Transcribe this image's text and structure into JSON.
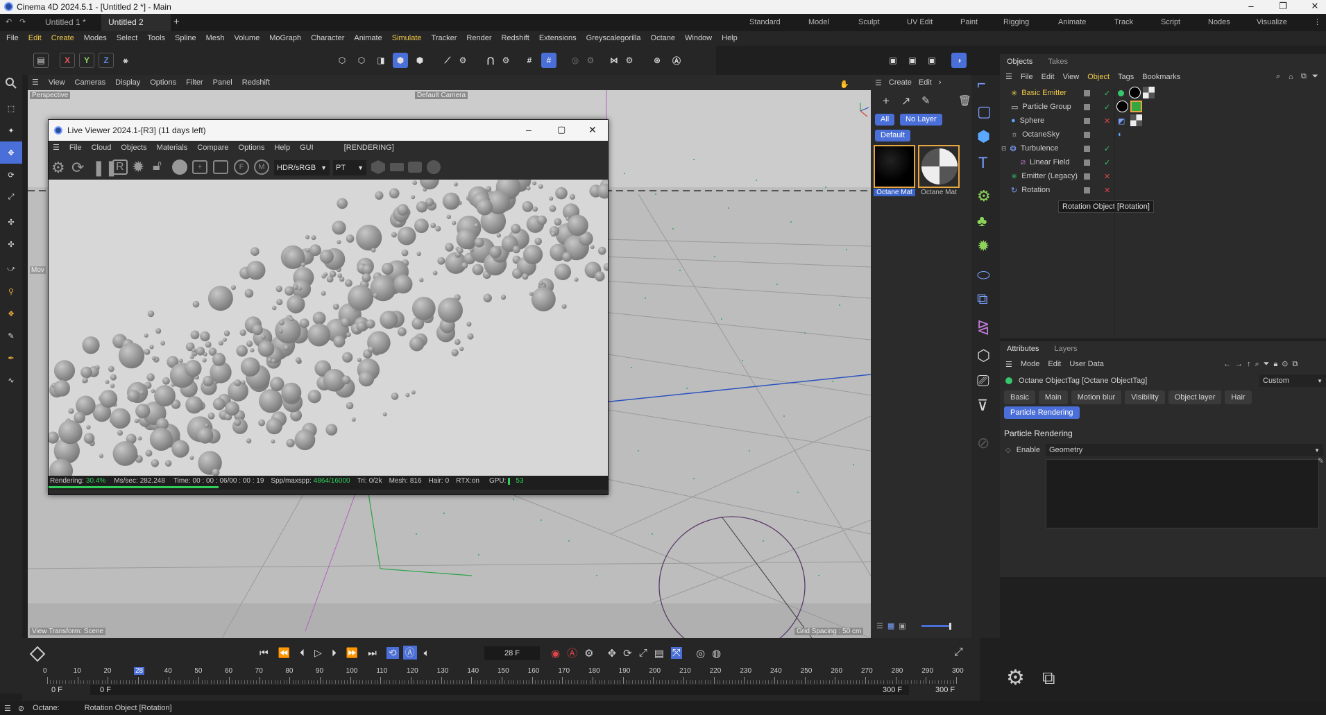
{
  "window": {
    "title": "Cinema 4D 2024.5.1 - [Untitled 2 *] - Main"
  },
  "doc_tabs": [
    {
      "label": "Untitled 1 *"
    },
    {
      "label": "Untitled 2 *"
    }
  ],
  "layouts": [
    "Standard",
    "Model",
    "Sculpt",
    "UV Edit",
    "Paint",
    "Rigging",
    "Animate",
    "Track",
    "Script",
    "Nodes",
    "Visualize"
  ],
  "menu": [
    "File",
    "Edit",
    "Create",
    "Modes",
    "Select",
    "Tools",
    "Spline",
    "Mesh",
    "Volume",
    "MoGraph",
    "Character",
    "Animate",
    "Simulate",
    "Tracker",
    "Render",
    "Redshift",
    "Extensions",
    "Greyscalegorilla",
    "Octane",
    "Window",
    "Help"
  ],
  "axis_buttons": [
    "X",
    "Y",
    "Z"
  ],
  "viewport": {
    "menu": [
      "View",
      "Cameras",
      "Display",
      "Options",
      "Filter",
      "Panel",
      "Redshift"
    ],
    "label_perspective": "Perspective",
    "label_camera": "Default Camera",
    "view_transform": "View Transform: Scene",
    "grid_spacing": "Grid Spacing : 50 cm",
    "partial_label": "Mov"
  },
  "live_viewer": {
    "title": "Live Viewer 2024.1-[R3] (11 days left)",
    "menu": [
      "File",
      "Cloud",
      "Objects",
      "Materials",
      "Compare",
      "Options",
      "Help",
      "GUI"
    ],
    "render_state": "[RENDERING]",
    "color_space": "HDR/sRGB",
    "kernel": "PT",
    "status": {
      "rendering_label": "Rendering:",
      "rendering": "30.4%",
      "ms_label": "Ms/sec:",
      "ms": "282.248",
      "time_label": "Time:",
      "time": "00 : 00 : 06/00 : 00 : 19",
      "spp_label": "Spp/maxspp:",
      "spp": "4864/16000",
      "tri_label": "Tri:",
      "tri": "0/2k",
      "mesh_label": "Mesh:",
      "mesh": "816",
      "hair_label": "Hair:",
      "hair": "0",
      "rtx_label": "RTX:",
      "rtx": "on",
      "gpu_label": "GPU:",
      "gpu": "53"
    },
    "progress": 0.304
  },
  "materials": {
    "menu": [
      "Create",
      "Edit"
    ],
    "filter_all": "All",
    "filter_layer": "No Layer",
    "filter_default": "Default",
    "items": [
      {
        "label": "Octane Mat"
      },
      {
        "label": "Octane Mat"
      }
    ]
  },
  "objects_panel": {
    "tabs": [
      "Objects",
      "Takes"
    ],
    "menu": [
      "File",
      "Edit",
      "View",
      "Object",
      "Tags",
      "Bookmarks"
    ],
    "rows": [
      {
        "label": "Basic Emitter",
        "selected": true,
        "status": "check"
      },
      {
        "label": "Particle Group",
        "status": "check"
      },
      {
        "label": "Sphere",
        "status": "cross"
      },
      {
        "label": "OctaneSky",
        "status": ""
      },
      {
        "label": "Turbulence",
        "status": "check"
      },
      {
        "label": "Linear Field",
        "status": "check"
      },
      {
        "label": "Emitter (Legacy)",
        "status": "cross"
      },
      {
        "label": "Rotation",
        "status": "cross"
      }
    ],
    "tooltip": "Rotation Object [Rotation]"
  },
  "attributes": {
    "tabs": [
      "Attributes",
      "Layers"
    ],
    "menu": [
      "Mode",
      "Edit",
      "User Data"
    ],
    "object_label": "Octane ObjectTag [Octane ObjectTag]",
    "preset": "Custom",
    "section_buttons": [
      "Basic",
      "Main",
      "Motion blur",
      "Visibility",
      "Object layer",
      "Hair"
    ],
    "active_button": "Particle Rendering",
    "section_title": "Particle Rendering",
    "enable_label": "Enable",
    "enable_value": "Geometry"
  },
  "timeline": {
    "current_frame": "28 F",
    "ticks": [
      "0",
      "10",
      "20",
      "28",
      "40",
      "50",
      "60",
      "70",
      "80",
      "90",
      "100",
      "110",
      "120",
      "130",
      "140",
      "150",
      "160",
      "170",
      "180",
      "190",
      "200",
      "210",
      "220",
      "230",
      "240",
      "250",
      "260",
      "270",
      "280",
      "290",
      "300"
    ],
    "start_a": "0 F",
    "start_b": "0 F",
    "end_a": "300 F",
    "end_b": "300 F"
  },
  "statusbar": {
    "engine": "Octane:",
    "message": "Rotation Object [Rotation]"
  },
  "colors": {
    "accent": "#4a6fd8",
    "selected_obj": "#f0c94a",
    "check": "#36c76b",
    "cross": "#e0454a",
    "progress": "#2fcf5a"
  }
}
